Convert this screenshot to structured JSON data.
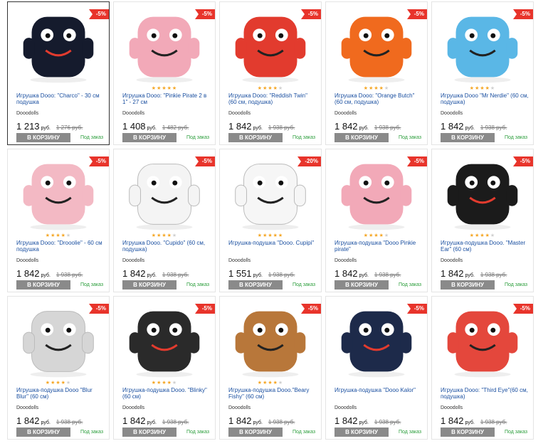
{
  "products": [
    {
      "title": "Игрушка Dooo: \"Charco\" - 30 см подушка",
      "brand": "Dooodolls",
      "price": "1 213",
      "currency": "руб.",
      "old_price": "1 276 руб.",
      "discount": "-5%",
      "rating": 0,
      "buy_label": "В КОРЗИНУ",
      "availability": "Под заказ",
      "color": "#151b2d",
      "icon": "charco-toy",
      "selected": true
    },
    {
      "title": "Игрушка Dooo: \"Pinkie Pirate 2 в 1\" - 27 см",
      "brand": "Dooodolls",
      "price": "1 408",
      "currency": "руб.",
      "old_price": "1 482 руб.",
      "discount": "-5%",
      "rating": 5,
      "buy_label": "В КОРЗИНУ",
      "availability": "Под заказ",
      "color": "#f2a9b8",
      "icon": "pinkie-pirate-toy"
    },
    {
      "title": "Игрушка Dooo: \"Reddish Twin\" (60 см, подушка)",
      "brand": "Dooodolls",
      "price": "1 842",
      "currency": "руб.",
      "old_price": "1 938 руб.",
      "discount": "-5%",
      "rating": 4,
      "buy_label": "В КОРЗИНУ",
      "availability": "Под заказ",
      "color": "#e23b2e",
      "icon": "reddish-twin-toy"
    },
    {
      "title": "Игрушка Dooo: \"Orange Butch\" (60 см, подушка)",
      "brand": "Dooodolls",
      "price": "1 842",
      "currency": "руб.",
      "old_price": "1 938 руб.",
      "discount": "-5%",
      "rating": 4,
      "buy_label": "В КОРЗИНУ",
      "availability": "Под заказ",
      "color": "#f06a1e",
      "icon": "orange-butch-toy"
    },
    {
      "title": "Игрушка Dooo \"Mr Nerdie\" (60 см, подушка)",
      "brand": "Dooodolls",
      "price": "1 842",
      "currency": "руб.",
      "old_price": "1 938 руб.",
      "discount": "-5%",
      "rating": 4,
      "buy_label": "В КОРЗИНУ",
      "availability": "Под заказ",
      "color": "#5ab7e6",
      "icon": "mr-nerdie-toy"
    },
    {
      "title": "Игрушка Dooo: \"Drooolie\" - 60 см подушка",
      "brand": "Dooodolls",
      "price": "1 842",
      "currency": "руб.",
      "old_price": "1 938 руб.",
      "discount": "-5%",
      "rating": 4,
      "buy_label": "В КОРЗИНУ",
      "availability": "Под заказ",
      "color": "#f3b9c4",
      "icon": "drooolie-toy"
    },
    {
      "title": "Игрушка Dooo. \"Cupido\" (60 см, подушка)",
      "brand": "Dooodolls",
      "price": "1 842",
      "currency": "руб.",
      "old_price": "1 938 руб.",
      "discount": "-5%",
      "rating": 4,
      "buy_label": "В КОРЗИНУ",
      "availability": "Под заказ",
      "color": "#f4f4f4",
      "icon": "cupido-toy"
    },
    {
      "title": "Игрушка-подушка \"Dooo. Cupipi\"",
      "brand": "Dooodolls",
      "price": "1 551",
      "currency": "руб.",
      "old_price": "1 938 руб.",
      "discount": "-20%",
      "rating": 5,
      "buy_label": "В КОРЗИНУ",
      "availability": "Под заказ",
      "color": "#f6f6f6",
      "icon": "cupipi-toy"
    },
    {
      "title": "Игрушка-подушка \"Dooo Pinkie pirate\"",
      "brand": "Dooodolls",
      "price": "1 842",
      "currency": "руб.",
      "old_price": "1 938 руб.",
      "discount": "-5%",
      "rating": 4,
      "buy_label": "В КОРЗИНУ",
      "availability": "Под заказ",
      "color": "#f2a9b8",
      "icon": "pinkie-pirate-pillow-toy"
    },
    {
      "title": "Игрушка-подушка Dooo. \"Master Ear\" (60 см)",
      "brand": "Dooodolls",
      "price": "1 842",
      "currency": "руб.",
      "old_price": "1 938 руб.",
      "discount": "-5%",
      "rating": 4,
      "buy_label": "В КОРЗИНУ",
      "availability": "Под заказ",
      "color": "#1b1b1b",
      "icon": "master-ear-toy"
    },
    {
      "title": "Игрушка-подушка Dooo \"Blur Blur\" (60 см)",
      "brand": "Dooodolls",
      "price": "1 842",
      "currency": "руб.",
      "old_price": "1 938 руб.",
      "discount": "-5%",
      "rating": 4,
      "buy_label": "В КОРЗИНУ",
      "availability": "Под заказ",
      "color": "#d6d6d6",
      "icon": "blur-blur-toy"
    },
    {
      "title": "Игрушка-подушка Dooo. \"Blinky\" (60 см)",
      "brand": "Dooodolls",
      "price": "1 842",
      "currency": "руб.",
      "old_price": "1 938 руб.",
      "discount": "-5%",
      "rating": 4,
      "buy_label": "В КОРЗИНУ",
      "availability": "Под заказ",
      "color": "#2a2a2a",
      "icon": "blinky-toy"
    },
    {
      "title": "Игрушка-подушка Dooo.\"Beary Fishy\" (60 см)",
      "brand": "Dooodolls",
      "price": "1 842",
      "currency": "руб.",
      "old_price": "1 938 руб.",
      "discount": "-5%",
      "rating": 4,
      "buy_label": "В КОРЗИНУ",
      "availability": "Под заказ",
      "color": "#b8773a",
      "icon": "beary-fishy-toy"
    },
    {
      "title": "Игрушка-подушка \"Dooo Kalor\"",
      "brand": "Dooodolls",
      "price": "1 842",
      "currency": "руб.",
      "old_price": "1 938 руб.",
      "discount": "-5%",
      "rating": 0,
      "buy_label": "В КОРЗИНУ",
      "availability": "Под заказ",
      "color": "#1d2a4a",
      "icon": "kalor-toy"
    },
    {
      "title": "Игрушка Dooo: \"Third Eye\"(60 см, подушка)",
      "brand": "Dooodolls",
      "price": "1 842",
      "currency": "руб.",
      "old_price": "1 938 руб.",
      "discount": "-5%",
      "rating": 0,
      "buy_label": "В КОРЗИНУ",
      "availability": "Под заказ",
      "color": "#e4473c",
      "icon": "third-eye-toy"
    }
  ]
}
